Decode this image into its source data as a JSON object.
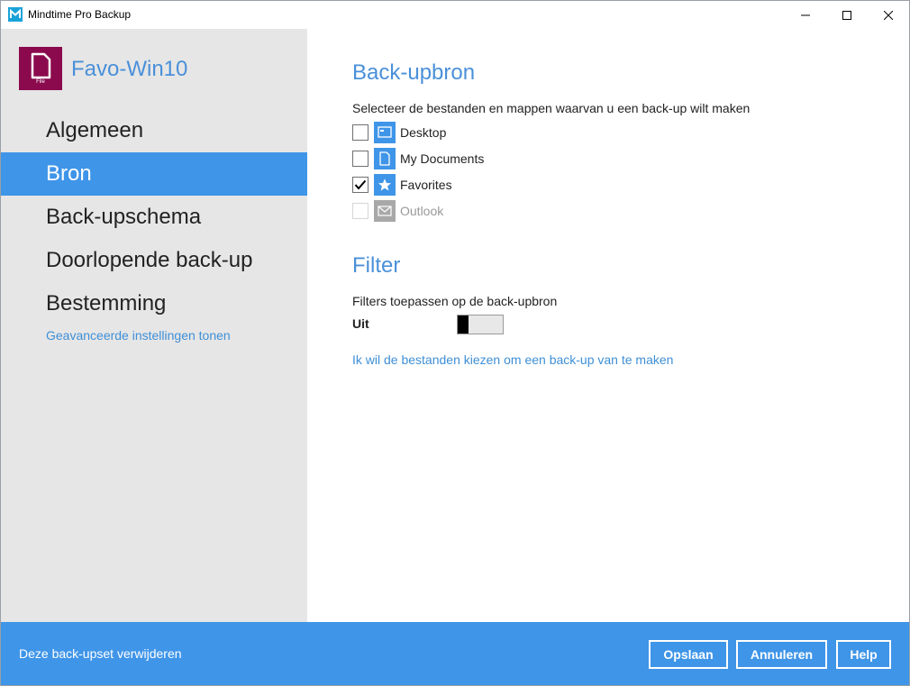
{
  "window": {
    "title": "Mindtime Pro Backup"
  },
  "sidebar": {
    "backup_set_name": "Favo-Win10",
    "backup_set_icon_label": "File",
    "items": [
      {
        "label": "Algemeen",
        "active": false
      },
      {
        "label": "Bron",
        "active": true
      },
      {
        "label": "Back-upschema",
        "active": false
      },
      {
        "label": "Doorlopende back-up",
        "active": false
      },
      {
        "label": "Bestemming",
        "active": false
      }
    ],
    "advanced_link": "Geavanceerde instellingen tonen"
  },
  "source": {
    "title": "Back-upbron",
    "description": "Selecteer de bestanden en mappen waarvan u een back-up wilt maken",
    "items": [
      {
        "label": "Desktop",
        "icon": "desktop-icon",
        "checked": false,
        "disabled": false
      },
      {
        "label": "My Documents",
        "icon": "document-icon",
        "checked": false,
        "disabled": false
      },
      {
        "label": "Favorites",
        "icon": "star-icon",
        "checked": true,
        "disabled": false
      },
      {
        "label": "Outlook",
        "icon": "mail-icon",
        "checked": false,
        "disabled": true
      }
    ]
  },
  "filter": {
    "title": "Filter",
    "description": "Filters toepassen op de back-upbron",
    "toggle_label": "Uit",
    "toggle_on": false,
    "choose_files_link": "Ik wil de bestanden kiezen om een back-up van te maken"
  },
  "footer": {
    "delete_link": "Deze back-upset verwijderen",
    "save_label": "Opslaan",
    "cancel_label": "Annuleren",
    "help_label": "Help"
  },
  "colors": {
    "accent": "#3f95e8",
    "title_text": "#4a90d9",
    "icon_tile": "#8b0a4e"
  }
}
